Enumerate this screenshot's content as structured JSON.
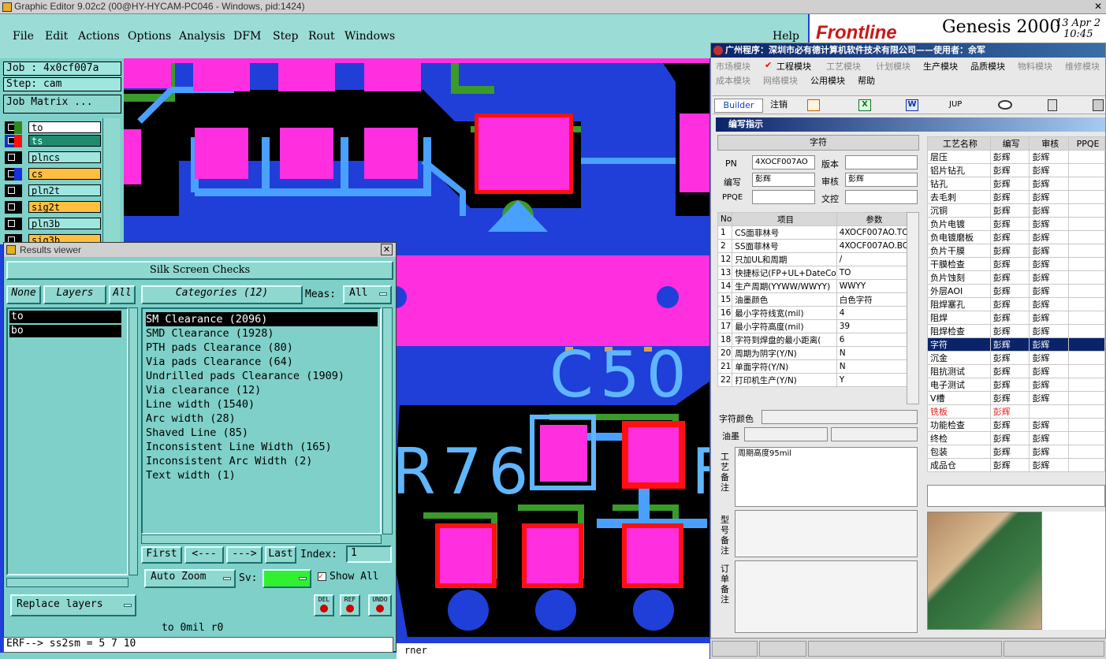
{
  "window": {
    "title": "Graphic Editor 9.02c2 (00@HY-HYCAM-PC046 - Windows, pid:1424)"
  },
  "menu": [
    "File",
    "Edit",
    "Actions",
    "Options",
    "Analysis",
    "DFM",
    "Step",
    "Rout",
    "Windows"
  ],
  "help": "Help",
  "job": {
    "job": "Job : 4x0cf007a",
    "step": "Step: cam",
    "matrix": "Job Matrix ..."
  },
  "layers": [
    "to",
    "ts",
    "plncs",
    "cs",
    "pln2t",
    "sig2t",
    "pln3b",
    "sig3b"
  ],
  "colors": {
    "pad": "#ff2fe0",
    "board": "#1f3fd8",
    "line": "#4aa0ff",
    "green": "#3c9a2a",
    "red": "#ff1010",
    "silk": "#5fb6ff"
  },
  "pcb": {
    "label1": "C50",
    "label2": "R76",
    "label3": "F"
  },
  "results": {
    "title": "Results viewer",
    "heading": "Silk Screen Checks",
    "none": "None",
    "layers": "Layers",
    "all": "All",
    "categories": "Categories (12)",
    "meas": "Meas:",
    "meas_val": "All",
    "layer_list": [
      "to",
      "bo"
    ],
    "items": [
      "SM Clearance (2096)",
      "SMD Clearance (1928)",
      "PTH pads Clearance (80)",
      "Via pads Clearance (64)",
      "Undrilled pads Clearance (1909)",
      "Via clearance (12)",
      "Line width (1540)",
      "Arc width (28)",
      "Shaved Line (85)",
      "Inconsistent Line Width (165)",
      "Inconsistent Arc Width (2)",
      "Text width (1)"
    ],
    "first": "First",
    "prev": "<---",
    "next": "--->",
    "last": "Last",
    "index": "Index:",
    "index_val": "1",
    "autozoom": "Auto Zoom",
    "sv": "Sv:",
    "showall": "Show All",
    "replace": "Replace layers",
    "del": "DEL",
    "ref": "REF",
    "undo": "UNDO",
    "status": "to 0mil  r0"
  },
  "cmd": {
    "text": "ERF--> ss2sm = 5 7 10",
    "tail": "rner"
  },
  "genesis": {
    "brand": "Frontline",
    "title": "Genesis 2000",
    "date": "13 Apr 2",
    "time": "10:45"
  },
  "erp": {
    "title": "广州程序：深圳市必有德计算机软件技术有限公司——使用者：佘军",
    "menus1": [
      "市场模块",
      "工程模块",
      "工艺模块",
      "计划模块",
      "生产模块",
      "品质模块",
      "物料模块",
      "维修模块"
    ],
    "menus2": [
      "成本模块",
      "网络模块",
      "公用模块",
      "帮助"
    ],
    "builder": "Builder",
    "logout": "注销",
    "jup": "JUP",
    "subtitle": "编写指示",
    "section": "字符",
    "pn_label": "PN",
    "pn": "4XOCF007AO",
    "ver_label": "版本",
    "writer_label": "编写",
    "writer": "彭辉",
    "reviewer_label": "审核",
    "reviewer": "彭辉",
    "ppqe_label": "PPQE",
    "doc_label": "文控",
    "table_head": [
      "No",
      "项目",
      "参数"
    ],
    "rows": [
      [
        "1",
        "CS面菲林号",
        "4XOCF007AO.TO"
      ],
      [
        "2",
        "SS面菲林号",
        "4XOCF007AO.BO"
      ],
      [
        "12",
        "只加UL和周期",
        "/"
      ],
      [
        "13",
        "快捷标记(FP+UL+DateCo",
        "TO"
      ],
      [
        "14",
        "生产周期(YYWW/WWYY)",
        "WWYY"
      ],
      [
        "15",
        "油墨颜色",
        "白色字符"
      ],
      [
        "16",
        "最小字符线宽(mil)",
        "4"
      ],
      [
        "17",
        "最小字符高度(mil)",
        "39"
      ],
      [
        "18",
        "字符到焊盘的最小距离(",
        "6"
      ],
      [
        "20",
        "周期为阴字(Y/N)",
        "N"
      ],
      [
        "21",
        "单面字符(Y/N)",
        "N"
      ],
      [
        "22",
        "打印机生产(Y/N)",
        "Y"
      ]
    ],
    "char_color": "字符颜色",
    "ink": "油墨",
    "note1_label": "工艺备注",
    "note1": "周期高度95mil",
    "note2_label": "型号备注",
    "note3_label": "订单备注",
    "proc_head": [
      "工艺名称",
      "编写",
      "审核",
      "PPQE"
    ],
    "procs": [
      [
        "层压",
        "彭辉",
        "彭辉"
      ],
      [
        "铝片钻孔",
        "彭辉",
        "彭辉"
      ],
      [
        "钻孔",
        "彭辉",
        "彭辉"
      ],
      [
        "去毛刺",
        "彭辉",
        "彭辉"
      ],
      [
        "沉铜",
        "彭辉",
        "彭辉"
      ],
      [
        "负片电镀",
        "彭辉",
        "彭辉"
      ],
      [
        "负电镀磨板",
        "彭辉",
        "彭辉"
      ],
      [
        "负片干膜",
        "彭辉",
        "彭辉"
      ],
      [
        "干膜检查",
        "彭辉",
        "彭辉"
      ],
      [
        "负片蚀刻",
        "彭辉",
        "彭辉"
      ],
      [
        "外层AOI",
        "彭辉",
        "彭辉"
      ],
      [
        "阻焊塞孔",
        "彭辉",
        "彭辉"
      ],
      [
        "阻焊",
        "彭辉",
        "彭辉"
      ],
      [
        "阻焊检查",
        "彭辉",
        "彭辉"
      ],
      [
        "字符",
        "彭辉",
        "彭辉"
      ],
      [
        "沉金",
        "彭辉",
        "彭辉"
      ],
      [
        "阻抗测试",
        "彭辉",
        "彭辉"
      ],
      [
        "电子测试",
        "彭辉",
        "彭辉"
      ],
      [
        "V槽",
        "彭辉",
        "彭辉"
      ],
      [
        "铣板",
        "彭辉",
        ""
      ],
      [
        "功能检查",
        "彭辉",
        "彭辉"
      ],
      [
        "终检",
        "彭辉",
        "彭辉"
      ],
      [
        "包装",
        "彭辉",
        "彭辉"
      ],
      [
        "成品仓",
        "彭辉",
        "彭辉"
      ]
    ]
  }
}
